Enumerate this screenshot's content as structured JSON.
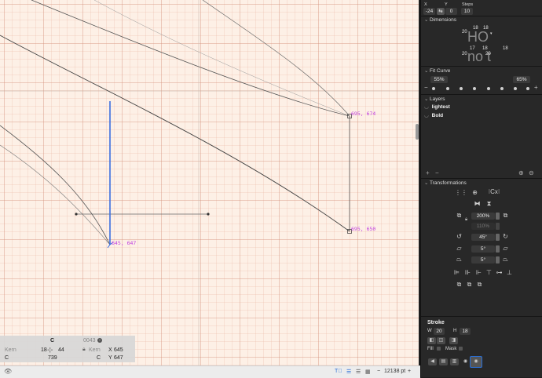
{
  "colors": {
    "canvas_bg": "#fdf0e6",
    "curve": "#555555",
    "selection_line": "#3b6fe0",
    "coord_label": "#c040e0",
    "panel_bg": "#282828",
    "accent": "#2a6fd6"
  },
  "canvas": {
    "coord_labels": [
      "695, 674",
      "695, 650",
      "645, 647"
    ]
  },
  "info": {
    "glyph": "C",
    "unicode": "0043",
    "kern_left_label": "Kern",
    "kern_right_label": "Kern",
    "left_metric": "18",
    "width": "44",
    "x_label": "X",
    "x_value": "645",
    "y_label": "Y",
    "y_value": "647",
    "glyph_name_left": "C",
    "width_value": "739",
    "glyph_name_right": "C"
  },
  "status": {
    "zoom_minus": "−",
    "zoom": "12138 pt",
    "zoom_plus": "+"
  },
  "panel": {
    "top": {
      "x_label": "X",
      "y_label": "Y",
      "steps_label": "Steps",
      "x_value": "-24",
      "y_value": "0",
      "steps_value": "10"
    },
    "dimensions": {
      "title": "Dimensions",
      "ghost_top": "HO",
      "ghost_bottom": "no t",
      "numbers": [
        "18",
        "18",
        "20",
        "17",
        "18",
        "18",
        "20",
        "20"
      ]
    },
    "fit_curve": {
      "title": "Fit Curve",
      "left": "55%",
      "right": "65%",
      "minus": "−",
      "plus": "+"
    },
    "layers": {
      "title": "Layers",
      "items": [
        "lightest",
        "Bold"
      ],
      "add": "+",
      "remove": "−"
    },
    "transformations": {
      "title": "Transformations",
      "scale": "200%",
      "scale2": "110%",
      "rotate": "45°",
      "slant1": "5°",
      "slant2": "5°"
    },
    "stroke": {
      "title": "Stroke",
      "w_label": "W",
      "w_value": "20",
      "h_label": "H",
      "h_value": "18",
      "fill_label": "Fill",
      "mask_label": "Mask"
    }
  }
}
